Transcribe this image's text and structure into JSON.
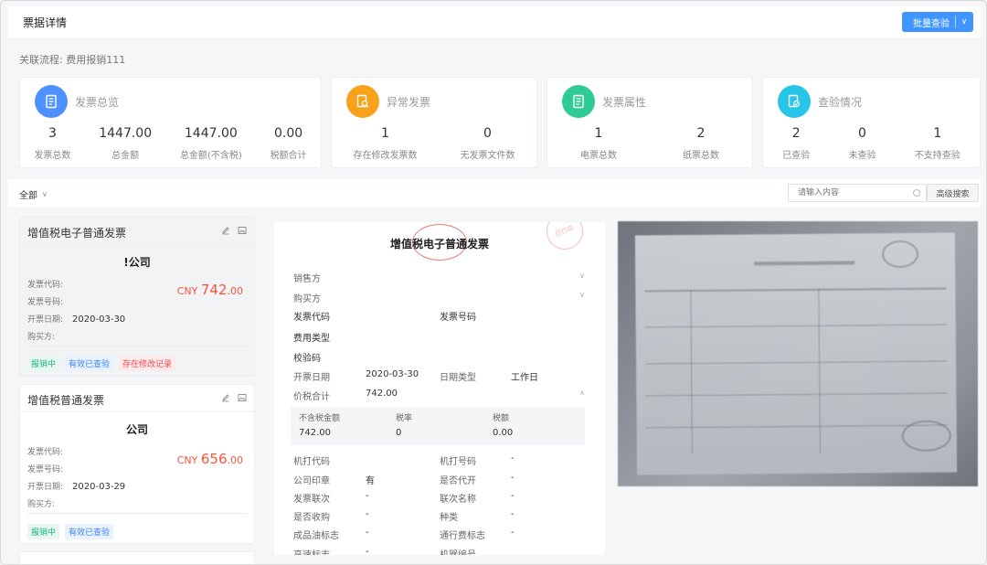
{
  "header": {
    "title": "票据详情",
    "batch_button": "批量查验"
  },
  "process": {
    "label": "关联流程:",
    "value": "费用报销111"
  },
  "stats": [
    {
      "title": "发票总览",
      "icon": "document-icon",
      "color": "#4d90fe",
      "items": [
        {
          "value": "3",
          "label": "发票总数"
        },
        {
          "value": "1447.00",
          "label": "总金额"
        },
        {
          "value": "1447.00",
          "label": "总金额(不含税)"
        },
        {
          "value": "0.00",
          "label": "税额合计"
        }
      ]
    },
    {
      "title": "异常发票",
      "icon": "search-doc-icon",
      "color": "#f7a21a",
      "items": [
        {
          "value": "1",
          "label": "存在修改发票数"
        },
        {
          "value": "0",
          "label": "无发票文件数"
        }
      ]
    },
    {
      "title": "发票属性",
      "icon": "document-icon",
      "color": "#2fcb95",
      "items": [
        {
          "value": "1",
          "label": "电票总数"
        },
        {
          "value": "2",
          "label": "纸票总数"
        }
      ]
    },
    {
      "title": "查验情况",
      "icon": "check-doc-icon",
      "color": "#27c5e8",
      "items": [
        {
          "value": "2",
          "label": "已查验"
        },
        {
          "value": "0",
          "label": "未查验"
        },
        {
          "value": "1",
          "label": "不支持查验"
        }
      ]
    }
  ],
  "filter": {
    "all": "全部",
    "search_placeholder": "请输入内容",
    "advanced": "高级搜索"
  },
  "list": [
    {
      "title": "增值税电子普通发票",
      "company": "!公司",
      "currency": "CNY",
      "amount_int": "742",
      "amount_dec": ".00",
      "code_label": "发票代码:",
      "number_label": "发票号码:",
      "date_label": "开票日期:",
      "date": "2020-03-30",
      "buyer_label": "购买方:",
      "tags": [
        {
          "text": "报销中",
          "color": "green"
        },
        {
          "text": "有效已查验",
          "color": "blue"
        },
        {
          "text": "存在修改记录",
          "color": "red"
        }
      ]
    },
    {
      "title": "增值税普通发票",
      "company": "公司",
      "currency": "CNY",
      "amount_int": "656",
      "amount_dec": ".00",
      "code_label": "发票代码:",
      "number_label": "发票号码:",
      "date_label": "开票日期:",
      "date": "2020-03-29",
      "buyer_label": "购买方:",
      "tags": [
        {
          "text": "报销中",
          "color": "green"
        },
        {
          "text": "有效已查验",
          "color": "blue"
        }
      ]
    }
  ],
  "detail": {
    "title": "增值税电子普通发票",
    "stamp_text": "已打印",
    "seller": "销售方",
    "buyer": "购买方",
    "code": "发票代码",
    "number": "发票号码",
    "expense_type": "费用类型",
    "check_code": "校验码",
    "date_label": "开票日期",
    "date_value": "2020-03-30",
    "date_type_label": "日期类型",
    "date_type_value": "工作日",
    "total_label": "价税合计",
    "total_value": "742.00",
    "tax_headers": [
      "不含税金额",
      "税率",
      "税额"
    ],
    "tax_values": [
      "742.00",
      "0",
      "0.00"
    ],
    "fields": [
      {
        "l1": "机打代码",
        "v1": "",
        "l2": "机打号码",
        "v2": "-"
      },
      {
        "l1": "公司印章",
        "v1": "有",
        "l2": "是否代开",
        "v2": "-"
      },
      {
        "l1": "发票联次",
        "v1": "-",
        "l2": "联次名称",
        "v2": "-"
      },
      {
        "l1": "是否收购",
        "v1": "-",
        "l2": "种类",
        "v2": "-"
      },
      {
        "l1": "成品油标志",
        "v1": "-",
        "l2": "通行费标志",
        "v2": "-"
      },
      {
        "l1": "高速标志",
        "v1": "-",
        "l2": "机器编号",
        "v2": ""
      }
    ]
  }
}
